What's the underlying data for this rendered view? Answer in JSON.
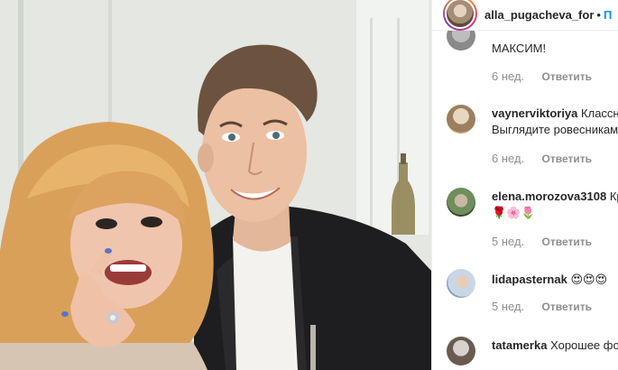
{
  "post": {
    "author": "alla_pugacheva_for",
    "separator": "•",
    "follow_label": "П"
  },
  "comments": [
    {
      "username": "",
      "text_lines": [
        "МАКСИМ!"
      ],
      "age": "6 нед.",
      "reply_label": "Ответить",
      "avatar_colors": [
        "#bdbdbd",
        "#8a8a8a"
      ]
    },
    {
      "username": "vaynerviktoriya",
      "text_lines": [
        "Классн",
        "Выглядите ровесникам"
      ],
      "age": "6 нед.",
      "reply_label": "Ответить",
      "avatar_colors": [
        "#d9c3a6",
        "#9b7f5f"
      ]
    },
    {
      "username": "elena.morozova3108",
      "text_lines": [
        "Кр",
        "🌹🌸🌷"
      ],
      "age": "5 нед.",
      "reply_label": "Ответить",
      "avatar_colors": [
        "#6f8e5c",
        "#2f4a2a"
      ]
    },
    {
      "username": "lidapasternak",
      "text_lines": [
        "😍😍😍"
      ],
      "age": "5 нед.",
      "reply_label": "Ответить",
      "avatar_colors": [
        "#c9d6e6",
        "#8aa0b8"
      ]
    },
    {
      "username": "tatamerka",
      "text_lines": [
        "Хорошее фо"
      ],
      "age": "",
      "reply_label": "",
      "avatar_colors": [
        "#d8d2cc",
        "#6b5a50"
      ]
    }
  ]
}
